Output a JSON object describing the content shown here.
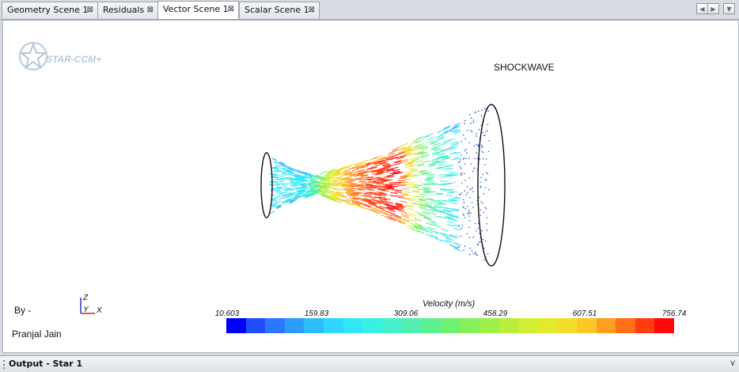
{
  "tabs": [
    {
      "label": "Geometry Scene 1"
    },
    {
      "label": "Residuals"
    },
    {
      "label": "Vector Scene 1"
    },
    {
      "label": "Scalar Scene 1"
    }
  ],
  "close_glyph": "⊠",
  "active_tab": "Vector Scene 1",
  "logo": {
    "text": "STAR-CCM+"
  },
  "scene": {
    "title": "SHOCKWAVE",
    "by_label": "By -",
    "author": "Pranjal Jain",
    "axes": {
      "z": "Z",
      "y": "Y",
      "x": "X"
    }
  },
  "legend": {
    "title": "Velocity (m/s)",
    "ticks": [
      "10.603",
      "159.83",
      "309.06",
      "458.29",
      "607.51",
      "756.74"
    ],
    "colors": [
      "#0000ff",
      "#1f4dff",
      "#2a78ff",
      "#2e9cff",
      "#2fbcff",
      "#2fd6ff",
      "#33e6f5",
      "#3af0e2",
      "#45f2cc",
      "#52f0b0",
      "#5ef090",
      "#6ef072",
      "#84f05a",
      "#9ef049",
      "#b8ef3c",
      "#cfee34",
      "#e3e92e",
      "#f3dd2a",
      "#fcc726",
      "#ff9f1f",
      "#ff6f18",
      "#ff3b10",
      "#ff0a08"
    ]
  },
  "nav": {
    "left": "◀",
    "right": "▶",
    "menu": "▼"
  },
  "output_panel": {
    "label": "Output - Star 1",
    "arrow": "⋎"
  }
}
